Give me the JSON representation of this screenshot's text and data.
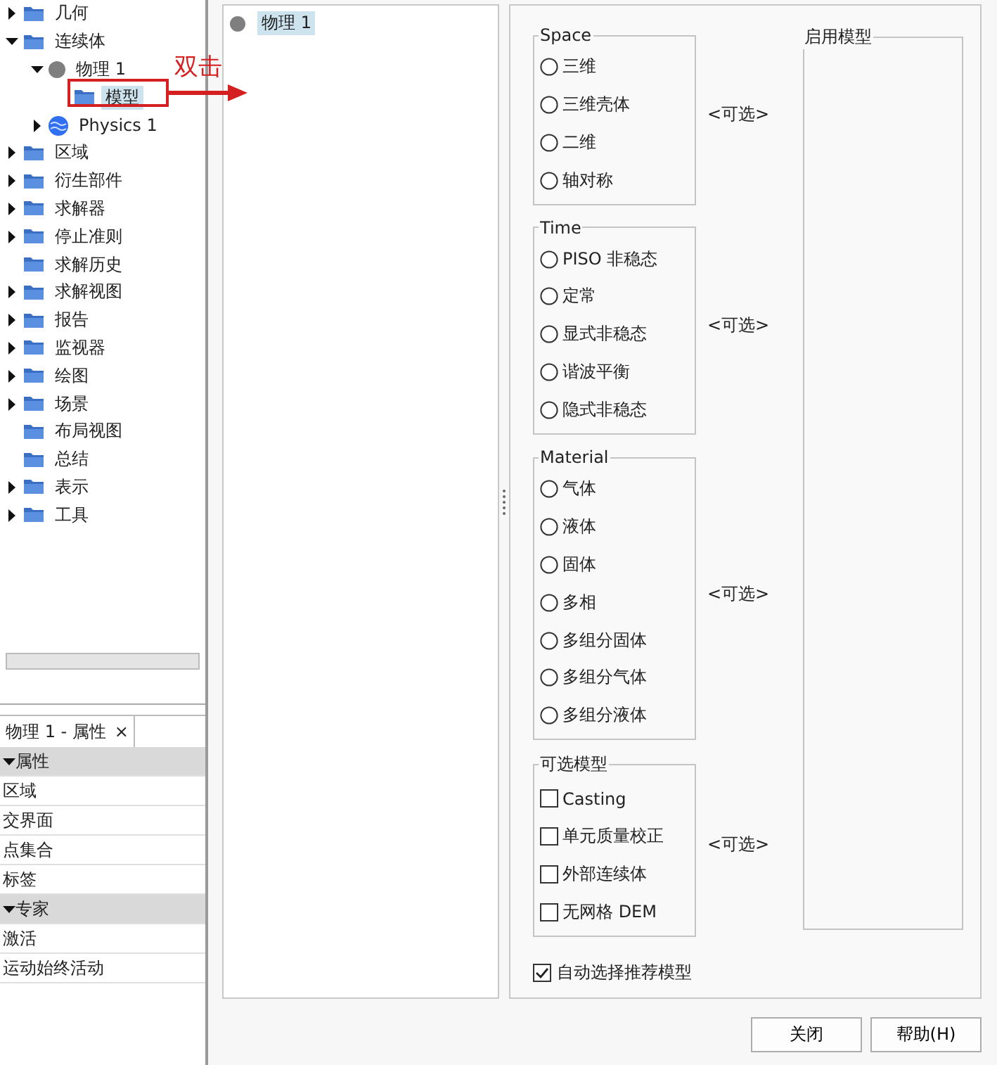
{
  "tree": [
    {
      "label": "几何",
      "kind": "folder",
      "expandable": true,
      "expanded": false,
      "selected": false
    },
    {
      "label": "连续体",
      "kind": "folder",
      "expandable": true,
      "expanded": true,
      "selected": false,
      "children": [
        {
          "label": "物理 1",
          "kind": "dot",
          "expandable": true,
          "expanded": true,
          "selected": false,
          "children": [
            {
              "label": "模型",
              "kind": "folder",
              "expandable": false,
              "selected": true
            }
          ]
        },
        {
          "label": "Physics 1",
          "kind": "sphere",
          "expandable": true,
          "expanded": false,
          "selected": false
        }
      ]
    },
    {
      "label": "区域",
      "kind": "folder",
      "expandable": true,
      "expanded": false,
      "selected": false
    },
    {
      "label": "衍生部件",
      "kind": "folder",
      "expandable": true,
      "expanded": false,
      "selected": false
    },
    {
      "label": "求解器",
      "kind": "folder",
      "expandable": true,
      "expanded": false,
      "selected": false
    },
    {
      "label": "停止准则",
      "kind": "folder",
      "expandable": true,
      "expanded": false,
      "selected": false
    },
    {
      "label": "求解历史",
      "kind": "folder",
      "expandable": false,
      "selected": false
    },
    {
      "label": "求解视图",
      "kind": "folder",
      "expandable": true,
      "expanded": false,
      "selected": false
    },
    {
      "label": "报告",
      "kind": "folder",
      "expandable": true,
      "expanded": false,
      "selected": false
    },
    {
      "label": "监视器",
      "kind": "folder",
      "expandable": true,
      "expanded": false,
      "selected": false
    },
    {
      "label": "绘图",
      "kind": "folder",
      "expandable": true,
      "expanded": false,
      "selected": false
    },
    {
      "label": "场景",
      "kind": "folder",
      "expandable": true,
      "expanded": false,
      "selected": false
    },
    {
      "label": "布局视图",
      "kind": "folder",
      "expandable": false,
      "selected": false
    },
    {
      "label": "总结",
      "kind": "folder",
      "expandable": false,
      "selected": false
    },
    {
      "label": "表示",
      "kind": "folder",
      "expandable": true,
      "expanded": false,
      "selected": false
    },
    {
      "label": "工具",
      "kind": "folder",
      "expandable": true,
      "expanded": false,
      "selected": false
    }
  ],
  "annotation": {
    "label": "双击"
  },
  "properties": {
    "tab": "物理 1 - 属性",
    "close": "×",
    "rows": [
      {
        "kind": "category",
        "label": "属性"
      },
      {
        "kind": "property",
        "label": "区域"
      },
      {
        "kind": "property",
        "label": "交界面"
      },
      {
        "kind": "property",
        "label": "点集合"
      },
      {
        "kind": "property",
        "label": "标签"
      },
      {
        "kind": "category",
        "label": "专家"
      },
      {
        "kind": "property",
        "label": "激活"
      },
      {
        "kind": "property",
        "label": "运动始终活动"
      }
    ]
  },
  "continua": [
    {
      "label": "物理 1",
      "selected": true
    }
  ],
  "groups": [
    {
      "title": "Space",
      "kind": "radio",
      "hint": "<可选>",
      "options": [
        {
          "label": "三维",
          "checked": false
        },
        {
          "label": "三维壳体",
          "checked": false
        },
        {
          "label": "二维",
          "checked": false
        },
        {
          "label": "轴对称",
          "checked": false
        }
      ]
    },
    {
      "title": "Time",
      "kind": "radio",
      "hint": "<可选>",
      "options": [
        {
          "label": "PISO 非稳态",
          "checked": false
        },
        {
          "label": "定常",
          "checked": false
        },
        {
          "label": "显式非稳态",
          "checked": false
        },
        {
          "label": "谐波平衡",
          "checked": false
        },
        {
          "label": "隐式非稳态",
          "checked": false
        }
      ]
    },
    {
      "title": "Material",
      "kind": "radio",
      "hint": "<可选>",
      "options": [
        {
          "label": "气体",
          "checked": false
        },
        {
          "label": "液体",
          "checked": false
        },
        {
          "label": "固体",
          "checked": false
        },
        {
          "label": "多相",
          "checked": false
        },
        {
          "label": "多组分固体",
          "checked": false
        },
        {
          "label": "多组分气体",
          "checked": false
        },
        {
          "label": "多组分液体",
          "checked": false
        }
      ]
    },
    {
      "title": "可选模型",
      "kind": "checkbox",
      "hint": "<可选>",
      "options": [
        {
          "label": "Casting",
          "checked": false
        },
        {
          "label": "单元质量校正",
          "checked": false
        },
        {
          "label": "外部连续体",
          "checked": false
        },
        {
          "label": "无网格 DEM",
          "checked": false
        }
      ]
    }
  ],
  "auto_select": {
    "label": "自动选择推荐模型",
    "checked": true
  },
  "enabled_models": {
    "title": "启用模型"
  },
  "buttons": [
    {
      "label": "关闭"
    },
    {
      "label": "帮助(H)"
    }
  ]
}
